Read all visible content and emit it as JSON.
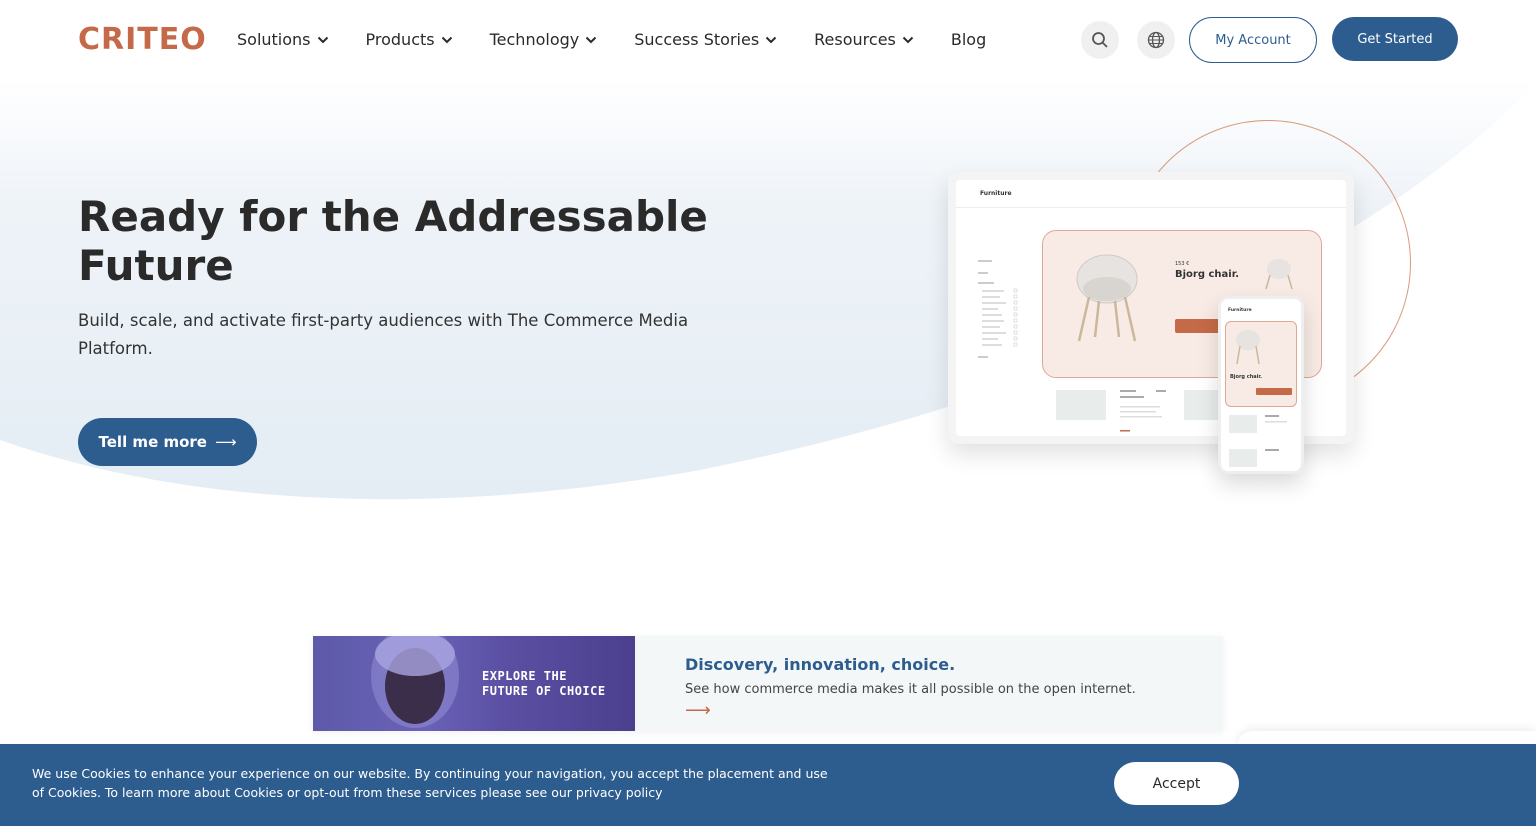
{
  "header": {
    "logo": "CRITEO",
    "nav": [
      {
        "label": "Solutions",
        "has_dropdown": true
      },
      {
        "label": "Products",
        "has_dropdown": true
      },
      {
        "label": "Technology",
        "has_dropdown": true
      },
      {
        "label": "Success Stories",
        "has_dropdown": true
      },
      {
        "label": "Resources",
        "has_dropdown": true
      },
      {
        "label": "Blog",
        "has_dropdown": false
      }
    ],
    "search_icon": "search-icon",
    "language_icon": "globe-icon",
    "account_label": "My Account",
    "get_started_label": "Get Started"
  },
  "hero": {
    "title": "Ready for the Addressable Future",
    "subtitle": "Build, scale, and activate first-party audiences with The Commerce Media Platform.",
    "cta_label": "Tell me more",
    "cta_arrow": "⟶"
  },
  "mockup": {
    "brand": "Furniture",
    "price": "153 €",
    "product": "Bjorg chair."
  },
  "promo": {
    "image_text": "EXPLORE THE\nFUTURE OF CHOICE",
    "title": "Discovery, innovation, choice.",
    "description": "See how commerce media makes it all possible on the open internet.",
    "arrow": "⟶"
  },
  "cookie": {
    "text": "We use Cookies to enhance your experience on our website. By continuing your navigation, you accept the placement and use of Cookies. To learn more about Cookies or opt-out from these services please see our privacy policy",
    "accept_label": "Accept"
  },
  "colors": {
    "brand": "#c56a48",
    "primary": "#2d5c8f",
    "hero_bg": "#e4edf4"
  }
}
